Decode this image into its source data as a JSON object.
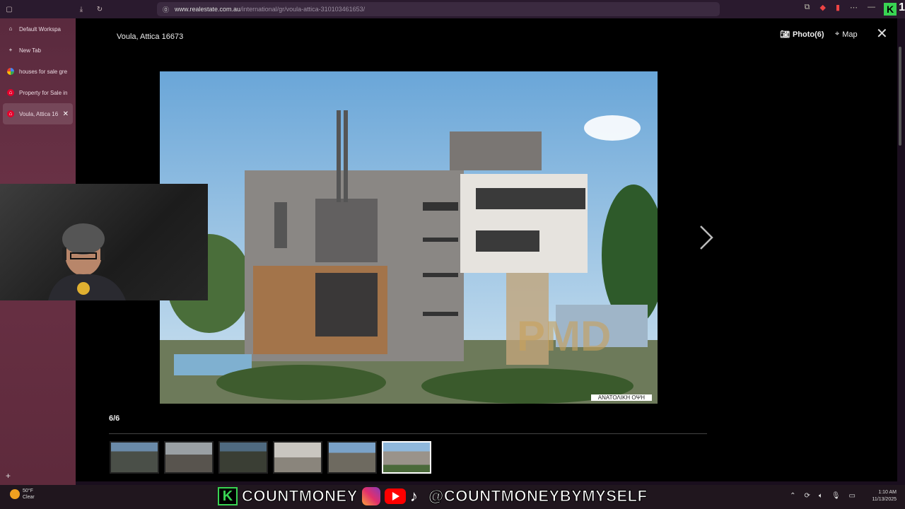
{
  "browser": {
    "url_host": "www.realestate.com.au",
    "url_path": "/international/gr/voula-attica-310103461653/"
  },
  "sidebar": {
    "items": [
      {
        "label": "Default Workspa",
        "icon": "workspace-icon"
      },
      {
        "label": "New Tab",
        "icon": "plus-icon"
      },
      {
        "label": "houses for sale gre",
        "icon": "google-icon"
      },
      {
        "label": "Property for Sale in",
        "icon": "realestate-icon"
      },
      {
        "label": "Voula, Attica 16",
        "icon": "realestate-icon",
        "active": true
      }
    ]
  },
  "modal": {
    "title": "Voula, Attica 16673",
    "photo_label": "Photo(6)",
    "map_label": "Map",
    "counter": "6/6",
    "caption": "ΑΝΑΤΟΛΙΚΗ ΟΨΗ",
    "watermark": "PMD",
    "thumbnail_count": 6,
    "selected_thumbnail": 6
  },
  "taskbar": {
    "temperature": "50°F",
    "condition": "Clear",
    "time": "1:10 AM",
    "date": "11/13/2025"
  },
  "overlay": {
    "brand_letter": "K",
    "handle_left": "COUNTMONEY",
    "handle_right": "@COUNTMONEYBYMYSELF",
    "corner_digit": "1"
  },
  "colors": {
    "accent_green": "#39d353",
    "sidebar_bg": "#5a2a3e",
    "modal_bg": "#000000"
  }
}
